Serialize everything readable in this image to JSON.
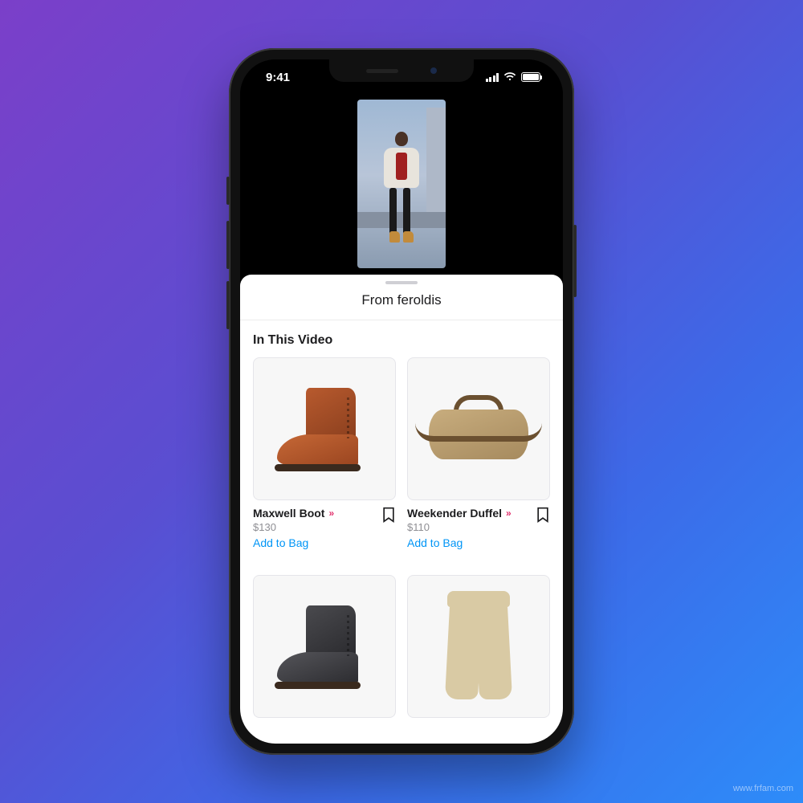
{
  "status": {
    "time": "9:41"
  },
  "sheet": {
    "title": "From feroldis",
    "section": "In This Video"
  },
  "products": [
    {
      "name": "Maxwell Boot",
      "price": "$130",
      "cta": "Add to Bag"
    },
    {
      "name": "Weekender Duffel",
      "price": "$110",
      "cta": "Add to Bag"
    }
  ],
  "watermark": "www.frfam.com"
}
